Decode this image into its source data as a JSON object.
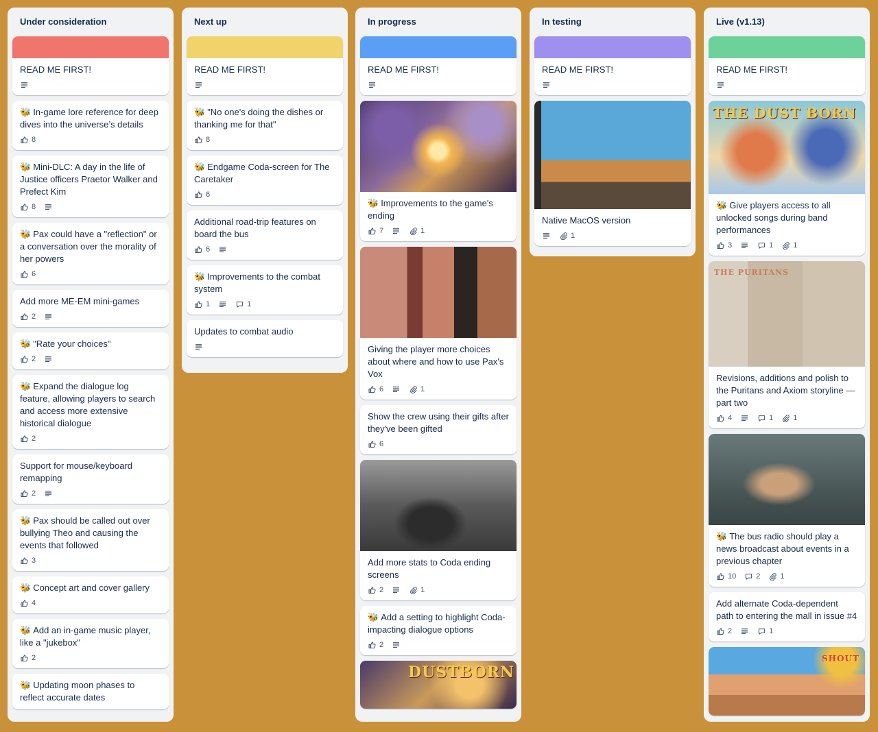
{
  "colors": {
    "background": "#c9923a",
    "red": "#f0766b",
    "yellow": "#f2d26b",
    "blue": "#5b9ef5",
    "purple": "#9f8fef",
    "green": "#6dd29a"
  },
  "icons": {
    "vote": "thumbs-up-icon",
    "description": "description-icon",
    "comments": "comment-icon",
    "attachments": "paperclip-icon",
    "bee": "bee-emoji"
  },
  "bee": "🐝",
  "lists": [
    {
      "title": "Under consideration",
      "cards": [
        {
          "title": "READ ME FIRST!"
        },
        {
          "title": "In-game lore reference for deep dives into the universe’s details",
          "votes": "8"
        },
        {
          "title": "Mini-DLC: A day in the life of Justice officers Praetor Walker and Prefect Kim",
          "votes": "8"
        },
        {
          "title": "Pax could have a \"reflection\" or a conversation over the morality of her powers",
          "votes": "6"
        },
        {
          "title": "Add more ME-EM mini-games",
          "votes": "2"
        },
        {
          "title": "\"Rate your choices\"",
          "votes": "2"
        },
        {
          "title": "Expand the dialogue log feature, allowing players to search and access more extensive historical dialogue",
          "votes": "2"
        },
        {
          "title": "Support for mouse/keyboard remapping",
          "votes": "2"
        },
        {
          "title": "Pax should be called out over bullying Theo and causing the events that followed",
          "votes": "3"
        },
        {
          "title": "Concept art and cover gallery",
          "votes": "4"
        },
        {
          "title": "Add an in-game music player, like a \"jukebox\"",
          "votes": "2"
        },
        {
          "title": "Updating moon phases to reflect accurate dates"
        }
      ]
    },
    {
      "title": "Next up",
      "cards": [
        {
          "title": "READ ME FIRST!"
        },
        {
          "title": "\"No one's doing the dishes or thanking me for that\"",
          "votes": "8"
        },
        {
          "title": "Endgame Coda-screen for The Caretaker",
          "votes": "6"
        },
        {
          "title": "Additional road-trip features on board the bus",
          "votes": "6"
        },
        {
          "title": "Improvements to the combat system",
          "votes": "1",
          "comments": "1"
        },
        {
          "title": "Updates to combat audio"
        }
      ]
    },
    {
      "title": "In progress",
      "cards": [
        {
          "title": "READ ME FIRST!"
        },
        {
          "title": "Improvements to the game's ending",
          "votes": "7",
          "attachments": "1"
        },
        {
          "title": "Giving the player more choices about where and how to use Pax's Vox",
          "votes": "6",
          "attachments": "1"
        },
        {
          "title": "Show the crew using their gifts after they've been gifted",
          "votes": "6"
        },
        {
          "title": "Add more stats to Coda ending screens",
          "votes": "2",
          "attachments": "1"
        },
        {
          "title": "Add a setting to highlight Coda-impacting dialogue options",
          "votes": "2"
        },
        {
          "image_text": "DUSTBORN"
        }
      ]
    },
    {
      "title": "In testing",
      "cards": [
        {
          "title": "READ ME FIRST!"
        },
        {
          "title": "Native MacOS version",
          "attachments": "1"
        }
      ]
    },
    {
      "title": "Live (v1.13)",
      "cards": [
        {
          "title": "READ ME FIRST!"
        },
        {
          "title": "Give players access to all unlocked songs during band performances",
          "votes": "3",
          "comments": "1",
          "attachments": "1",
          "image_text": "THE DUST BORN"
        },
        {
          "title": "Revisions, additions and polish to the Puritans and Axiom storyline — part two",
          "votes": "4",
          "comments": "1",
          "attachments": "1",
          "image_text": "THE PURITANS"
        },
        {
          "title": "The bus radio should play a news broadcast about events in a previous chapter",
          "votes": "10",
          "comments": "2",
          "attachments": "1"
        },
        {
          "title": "Add alternate Coda-dependent path to entering the mall in issue #4",
          "votes": "2",
          "comments": "1"
        },
        {
          "image_text": "SHOUT"
        }
      ]
    }
  ]
}
